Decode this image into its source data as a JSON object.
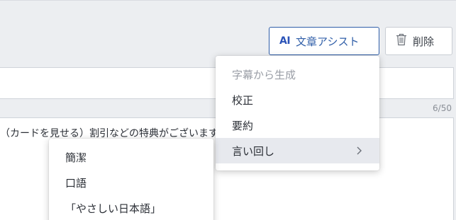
{
  "toolbar": {
    "ai_icon": "AI",
    "ai_assist_label": "文章アシスト",
    "delete_label": "削除"
  },
  "title_field": {
    "counter": "6/50"
  },
  "body_field": {
    "text": "（カードを見せる）割引などの特典がございます。"
  },
  "ai_menu": {
    "items": [
      {
        "label": "字幕から生成"
      },
      {
        "label": "校正"
      },
      {
        "label": "要約"
      },
      {
        "label": "言い回し"
      }
    ]
  },
  "phrasing_submenu": {
    "items": [
      {
        "label": "簡潔"
      },
      {
        "label": "口語"
      },
      {
        "label": "「やさしい日本語」"
      }
    ]
  },
  "colors": {
    "accent": "#2f5ea8",
    "background": "#eceef1",
    "hover": "#e7e9ee"
  }
}
